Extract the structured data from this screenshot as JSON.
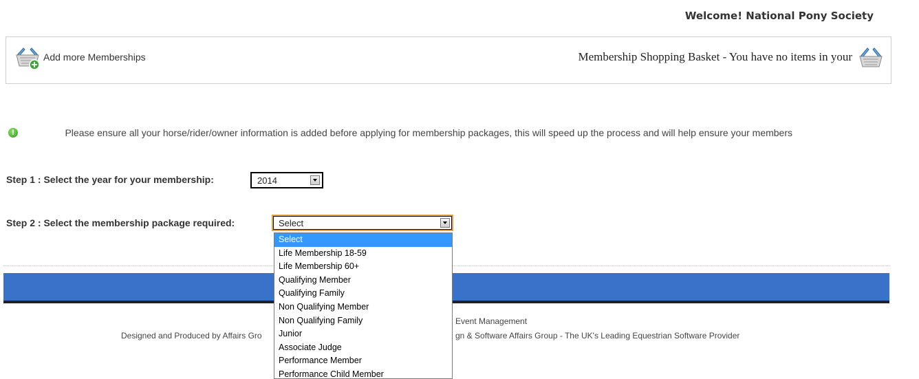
{
  "header": {
    "welcome_text": "Welcome! National Pony Society"
  },
  "basket_bar": {
    "add_more_label": "Add more Memberships",
    "add_icon": "basket-add-icon",
    "cart_text": "Membership Shopping Basket - You have no items in your",
    "cart_icon": "basket-icon"
  },
  "info": {
    "icon": "info-icon",
    "text": "Please ensure all your horse/rider/owner information is added before applying for membership packages, this will speed up the process and will help ensure your members"
  },
  "step1": {
    "label": "Step 1 : Select the year for your membership:",
    "selected_year": "2014"
  },
  "step2": {
    "label": "Step 2 : Select the membership package required:",
    "selected_value": "Select",
    "options": [
      "Select",
      "Life Membership 18-59",
      "Life Membership 60+",
      "Qualifying Member",
      "Qualifying Family",
      "Non Qualifying Member",
      "Non Qualifying Family",
      "Junior",
      "Associate Judge",
      "Performance Member",
      "Performance Child Member"
    ],
    "highlighted_index": 0
  },
  "footer": {
    "line1_right": "Event Management",
    "line2_left": "Designed and Produced by Affairs Gro",
    "line2_right": "gn & Software Affairs Group - The UK's Leading Equestrian Software Provider"
  },
  "colors": {
    "footer_band": "#3b72c9",
    "highlight": "#3399ff",
    "select_focus_border": "#e8a23a"
  }
}
